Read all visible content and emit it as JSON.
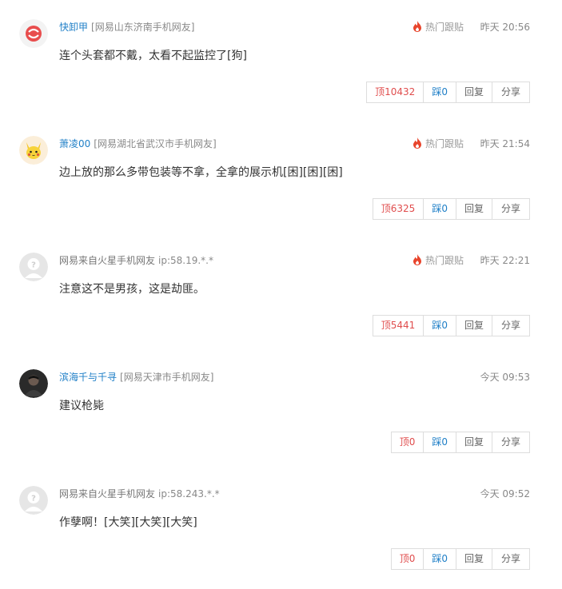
{
  "comments": [
    {
      "username": "快卸甲",
      "location": "[网易山东济南手机网友]",
      "hot_label": "热门跟贴",
      "time": "昨天 20:56",
      "content": "连个头套都不戴，太看不起监控了[狗]",
      "up": "顶10432",
      "down": "踩0",
      "reply": "回复",
      "share": "分享",
      "avatar_icon": "red-logo-avatar"
    },
    {
      "username": "萧凌00",
      "location": "[网易湖北省武汉市手机网友]",
      "hot_label": "热门跟贴",
      "time": "昨天 21:54",
      "content": "边上放的那么多带包装等不拿，全拿的展示机[困][困][困]",
      "up": "顶6325",
      "down": "踩0",
      "reply": "回复",
      "share": "分享",
      "avatar_icon": "pikachu-avatar"
    },
    {
      "username": "网易来自火星手机网友",
      "location": "ip:58.19.*.*",
      "hot_label": "热门跟贴",
      "time": "昨天 22:21",
      "content": "注意这不是男孩，这是劫匪。",
      "up": "顶5441",
      "down": "踩0",
      "reply": "回复",
      "share": "分享",
      "avatar_icon": "default-avatar"
    },
    {
      "username": "滨海千与千寻",
      "location": "[网易天津市手机网友]",
      "time": "今天 09:53",
      "content": "建议枪毙",
      "up": "顶0",
      "down": "踩0",
      "reply": "回复",
      "share": "分享",
      "avatar_icon": "photo-avatar"
    },
    {
      "username": "网易来自火星手机网友",
      "location": "ip:58.243.*.*",
      "time": "今天 09:52",
      "content": "作孽啊！[大笑][大笑][大笑]",
      "up": "顶0",
      "down": "踩0",
      "reply": "回复",
      "share": "分享",
      "avatar_icon": "default-avatar"
    }
  ],
  "colors": {
    "username": "#1f7fc7",
    "up": "#e04d4d",
    "down": "#1f7fc7",
    "hot_flame": "#e8452c"
  }
}
